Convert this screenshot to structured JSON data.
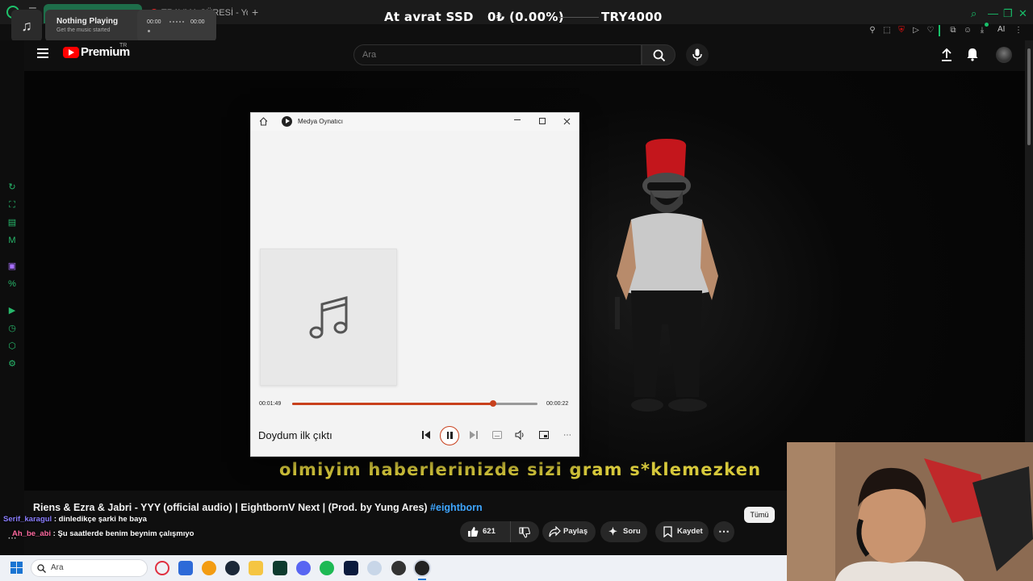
{
  "browser": {
    "tab_inactive_label": "TRAVMA ÇÜRESİ - YouTube",
    "newtab_glyph": "+",
    "accent": "#18c06a"
  },
  "ticker": {
    "name": "At avrat SSD",
    "change": "0₺ (0.00%)",
    "target": "TRY4000"
  },
  "music_widget": {
    "title": "Nothing Playing",
    "subtitle": "Get the music started",
    "time_start": "00:00",
    "time_end": "00:00",
    "icon": "music-note-icon"
  },
  "toolbar": {
    "ai_label": "AI"
  },
  "youtube": {
    "brand": "Premium",
    "region": "TR",
    "search_placeholder": "Ara",
    "brand_color": "#ff0000"
  },
  "player": {
    "app_title": "Medya Oynatıcı",
    "time_current": "00:01:49",
    "time_remaining": "00:00:22",
    "progress": 0.82,
    "song_title": "Doydum ilk çıktı",
    "accent": "#c8401c"
  },
  "video": {
    "subtitle": "olmiyim haberlerinizde sizi gram s*klemezken",
    "title": "Riens & Ezra & Jabri - YYY (official audio) | EightbornV Next | (Prod. by Yung Ares)",
    "hashtag": "#eightborn",
    "like_count": "621",
    "share_label": "Paylaş",
    "ask_label": "Soru",
    "save_label": "Kaydet",
    "all_chip": "Tümü"
  },
  "chat": [
    {
      "user": "Serif_karagul",
      "message": "dinledikçe şarki he baya"
    },
    {
      "user": "Ah_be_abi",
      "message": "Şu saatlerde benim beynim çalışmıyo"
    }
  ],
  "taskbar": {
    "search_label": "Ara"
  }
}
